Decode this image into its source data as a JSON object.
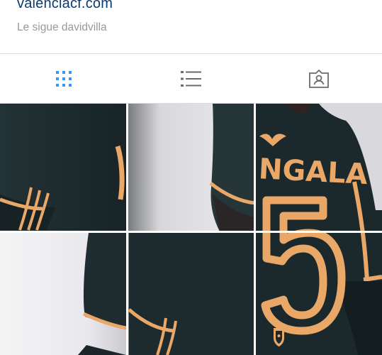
{
  "profile": {
    "website": "valenciacf.com",
    "followed_by": "Le sigue davidvilla"
  },
  "tabs": [
    {
      "name": "grid",
      "icon": "grid-icon",
      "active": true
    },
    {
      "name": "list",
      "icon": "list-icon",
      "active": false
    },
    {
      "name": "tagged",
      "icon": "tagged-photos-icon",
      "active": false
    }
  ],
  "photo": {
    "jersey_name": "NGALA",
    "jersey_number": "5",
    "tiles": 6
  },
  "colors": {
    "link": "#0d3a6b",
    "secondary_text": "#999999",
    "active_tab": "#3897f0",
    "inactive_tab": "#6b6b6b",
    "jersey": "#1d2a2e",
    "trim": "#e9a768"
  }
}
